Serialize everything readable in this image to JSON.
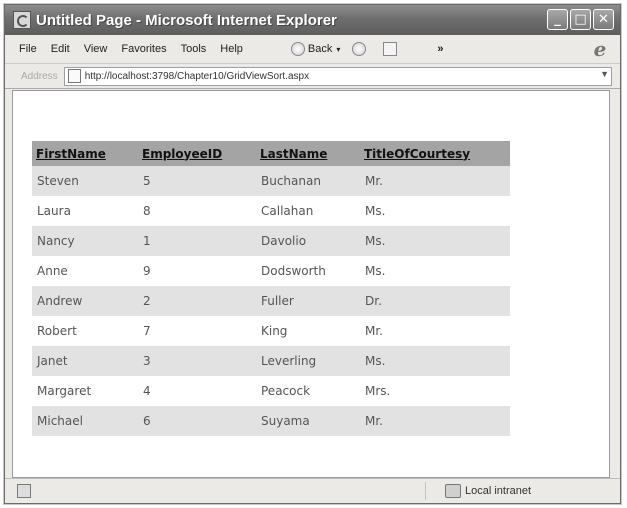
{
  "window": {
    "title": "Untitled Page - Microsoft Internet Explorer",
    "controls": {
      "minimize": "_",
      "maximize": "□",
      "close": "✕"
    }
  },
  "menubar": {
    "items": [
      "File",
      "Edit",
      "View",
      "Favorites",
      "Tools",
      "Help"
    ],
    "back_label": "Back",
    "more": "»"
  },
  "addressbar": {
    "label": "Address",
    "url": "http://localhost:3798/Chapter10/GridViewSort.aspx"
  },
  "grid": {
    "headers": [
      "FirstName",
      "EmployeeID",
      "LastName",
      "TitleOfCourtesy"
    ],
    "rows": [
      [
        "Steven",
        "5",
        "Buchanan",
        "Mr."
      ],
      [
        "Laura",
        "8",
        "Callahan",
        "Ms."
      ],
      [
        "Nancy",
        "1",
        "Davolio",
        "Ms."
      ],
      [
        "Anne",
        "9",
        "Dodsworth",
        "Ms."
      ],
      [
        "Andrew",
        "2",
        "Fuller",
        "Dr."
      ],
      [
        "Robert",
        "7",
        "King",
        "Mr."
      ],
      [
        "Janet",
        "3",
        "Leverling",
        "Ms."
      ],
      [
        "Margaret",
        "4",
        "Peacock",
        "Mrs."
      ],
      [
        "Michael",
        "6",
        "Suyama",
        "Mr."
      ]
    ]
  },
  "statusbar": {
    "zone": "Local intranet"
  },
  "colors": {
    "header_bg": "#a4a4a4",
    "alt_row_bg": "#e2e2e2",
    "titlebar": "#6e6e6e"
  },
  "icons": [
    "ie-page-icon",
    "minimize-icon",
    "maximize-icon",
    "close-icon",
    "back-icon",
    "forward-icon",
    "refresh-icon",
    "ie-logo-icon",
    "page-icon",
    "intranet-zone-icon"
  ]
}
